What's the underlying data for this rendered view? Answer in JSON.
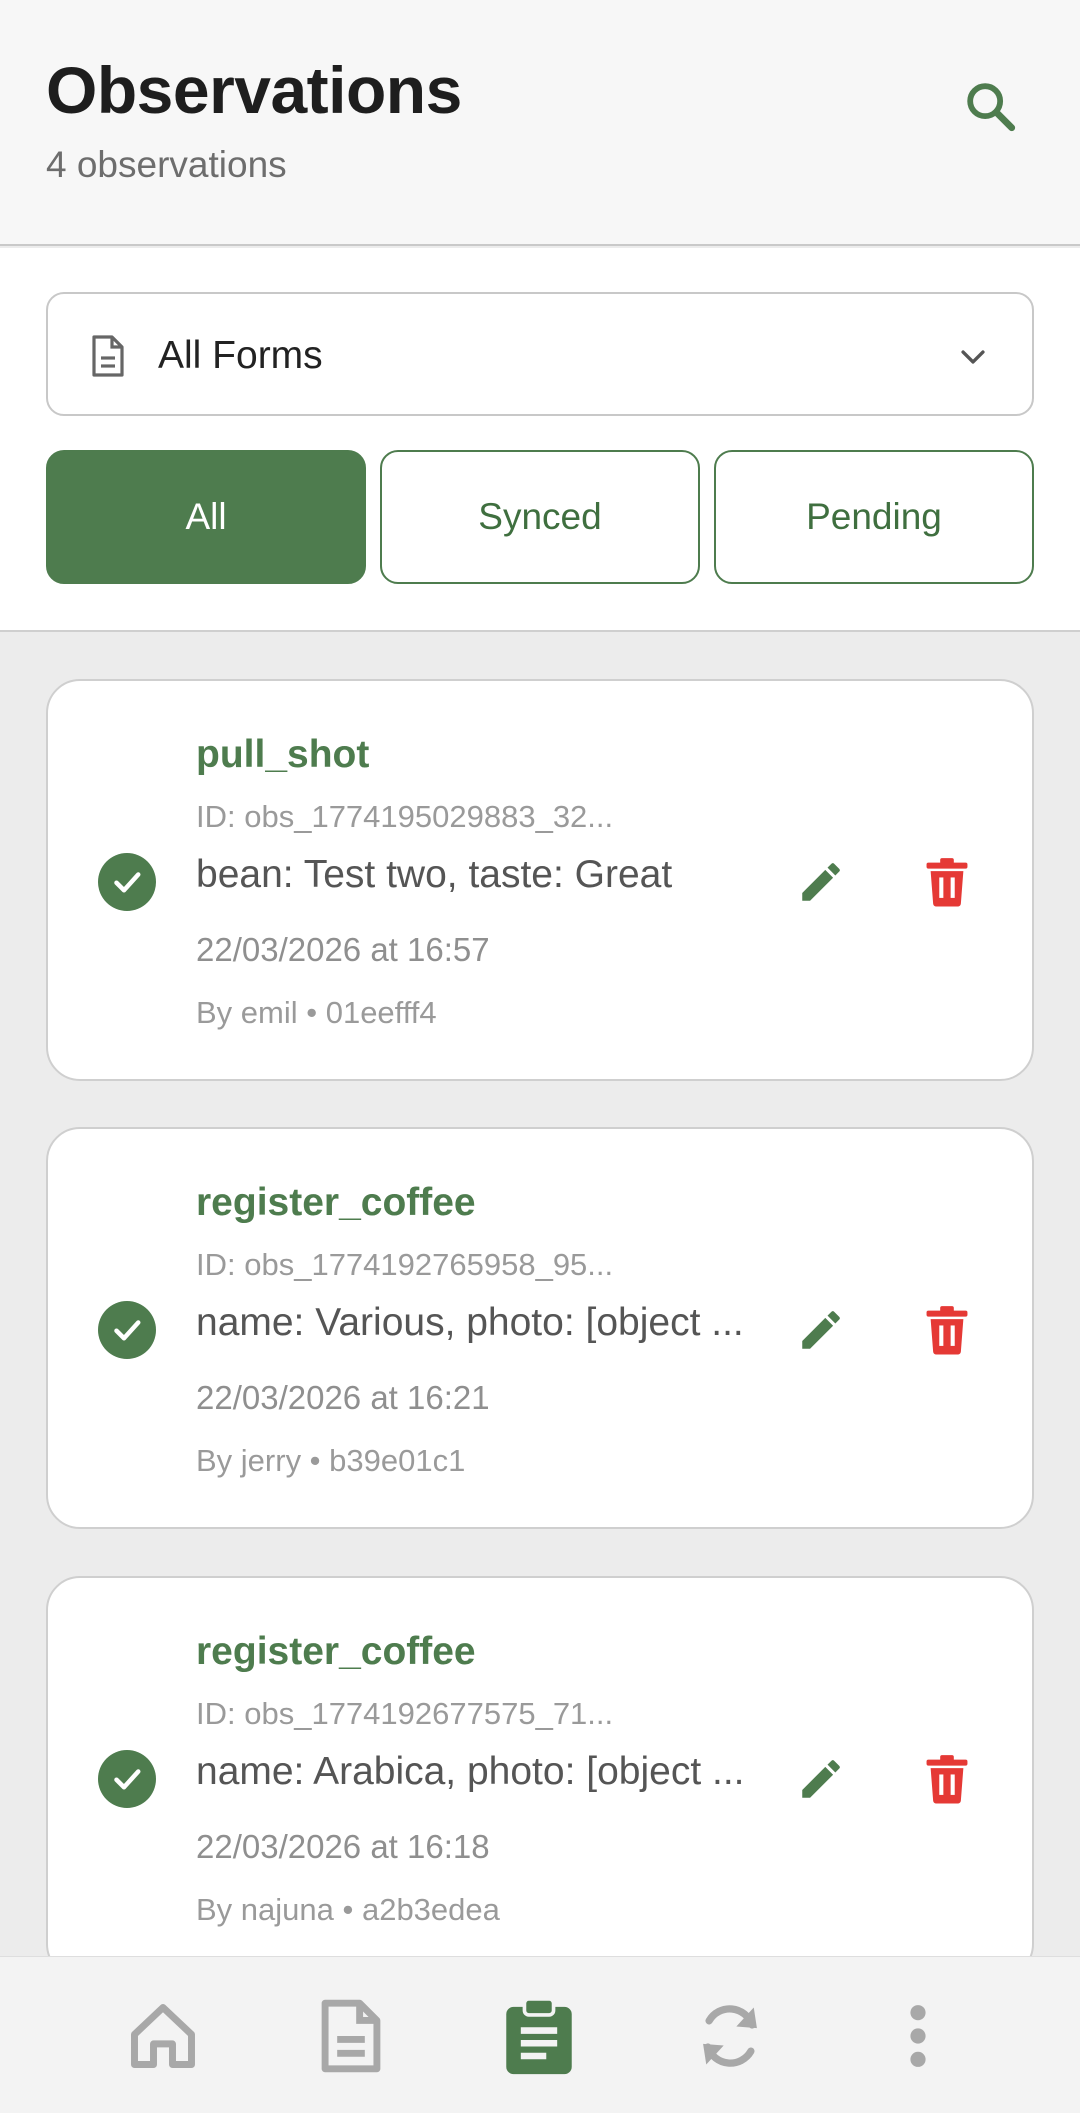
{
  "header": {
    "title": "Observations",
    "subtitle": "4 observations",
    "search_icon": "search-icon"
  },
  "filters": {
    "form_select": {
      "value": "All Forms",
      "icon": "document-icon"
    },
    "chips": [
      {
        "label": "All",
        "active": true
      },
      {
        "label": "Synced",
        "active": false
      },
      {
        "label": "Pending",
        "active": false
      }
    ]
  },
  "observations": [
    {
      "form": "pull_shot",
      "id": "ID: obs_1774195029883_32...",
      "summary": "bean: Test two, taste: Great",
      "date": "22/03/2026 at 16:57",
      "by": "By emil • 01eefff4",
      "status": "synced"
    },
    {
      "form": "register_coffee",
      "id": "ID: obs_1774192765958_95...",
      "summary": "name: Various, photo: [object ...",
      "date": "22/03/2026 at 16:21",
      "by": "By jerry • b39e01c1",
      "status": "synced"
    },
    {
      "form": "register_coffee",
      "id": "ID: obs_1774192677575_71...",
      "summary": "name: Arabica, photo: [object ...",
      "date": "22/03/2026 at 16:18",
      "by": "By najuna • a2b3edea",
      "status": "synced"
    }
  ],
  "nav": {
    "items": [
      {
        "icon": "home-icon",
        "active": false
      },
      {
        "icon": "forms-icon",
        "active": false
      },
      {
        "icon": "observations-icon",
        "active": true
      },
      {
        "icon": "sync-icon",
        "active": false
      },
      {
        "icon": "more-icon",
        "active": false
      }
    ]
  },
  "colors": {
    "primary": "#4e7c4e",
    "danger": "#e53935",
    "nav_inactive": "#a8a8a8"
  }
}
